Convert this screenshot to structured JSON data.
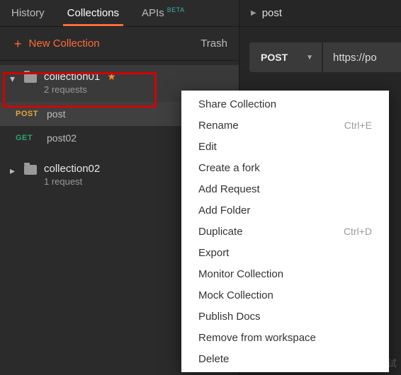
{
  "tabs": {
    "history": "History",
    "collections": "Collections",
    "apis": "APIs",
    "beta": "BETA"
  },
  "actions": {
    "new_collection": "New Collection",
    "trash": "Trash"
  },
  "collections": [
    {
      "name": "collection01",
      "starred": true,
      "subtitle": "2 requests",
      "expanded": true,
      "selected": true,
      "requests": [
        {
          "method": "POST",
          "name": "post"
        },
        {
          "method": "GET",
          "name": "post02"
        }
      ]
    },
    {
      "name": "collection02",
      "starred": false,
      "subtitle": "1 request",
      "expanded": false,
      "selected": false,
      "requests": []
    }
  ],
  "right": {
    "tab_label": "post",
    "method": "POST",
    "url": "https://po"
  },
  "context_menu": [
    {
      "label": "Share Collection",
      "shortcut": ""
    },
    {
      "label": "Rename",
      "shortcut": "Ctrl+E"
    },
    {
      "label": "Edit",
      "shortcut": ""
    },
    {
      "label": "Create a fork",
      "shortcut": ""
    },
    {
      "label": "Add Request",
      "shortcut": ""
    },
    {
      "label": "Add Folder",
      "shortcut": ""
    },
    {
      "label": "Duplicate",
      "shortcut": "Ctrl+D"
    },
    {
      "label": "Export",
      "shortcut": ""
    },
    {
      "label": "Monitor Collection",
      "shortcut": ""
    },
    {
      "label": "Mock Collection",
      "shortcut": ""
    },
    {
      "label": "Publish Docs",
      "shortcut": ""
    },
    {
      "label": "Remove from workspace",
      "shortcut": ""
    },
    {
      "label": "Delete",
      "shortcut": ""
    }
  ],
  "watermark": "知乎@海哥说测试"
}
